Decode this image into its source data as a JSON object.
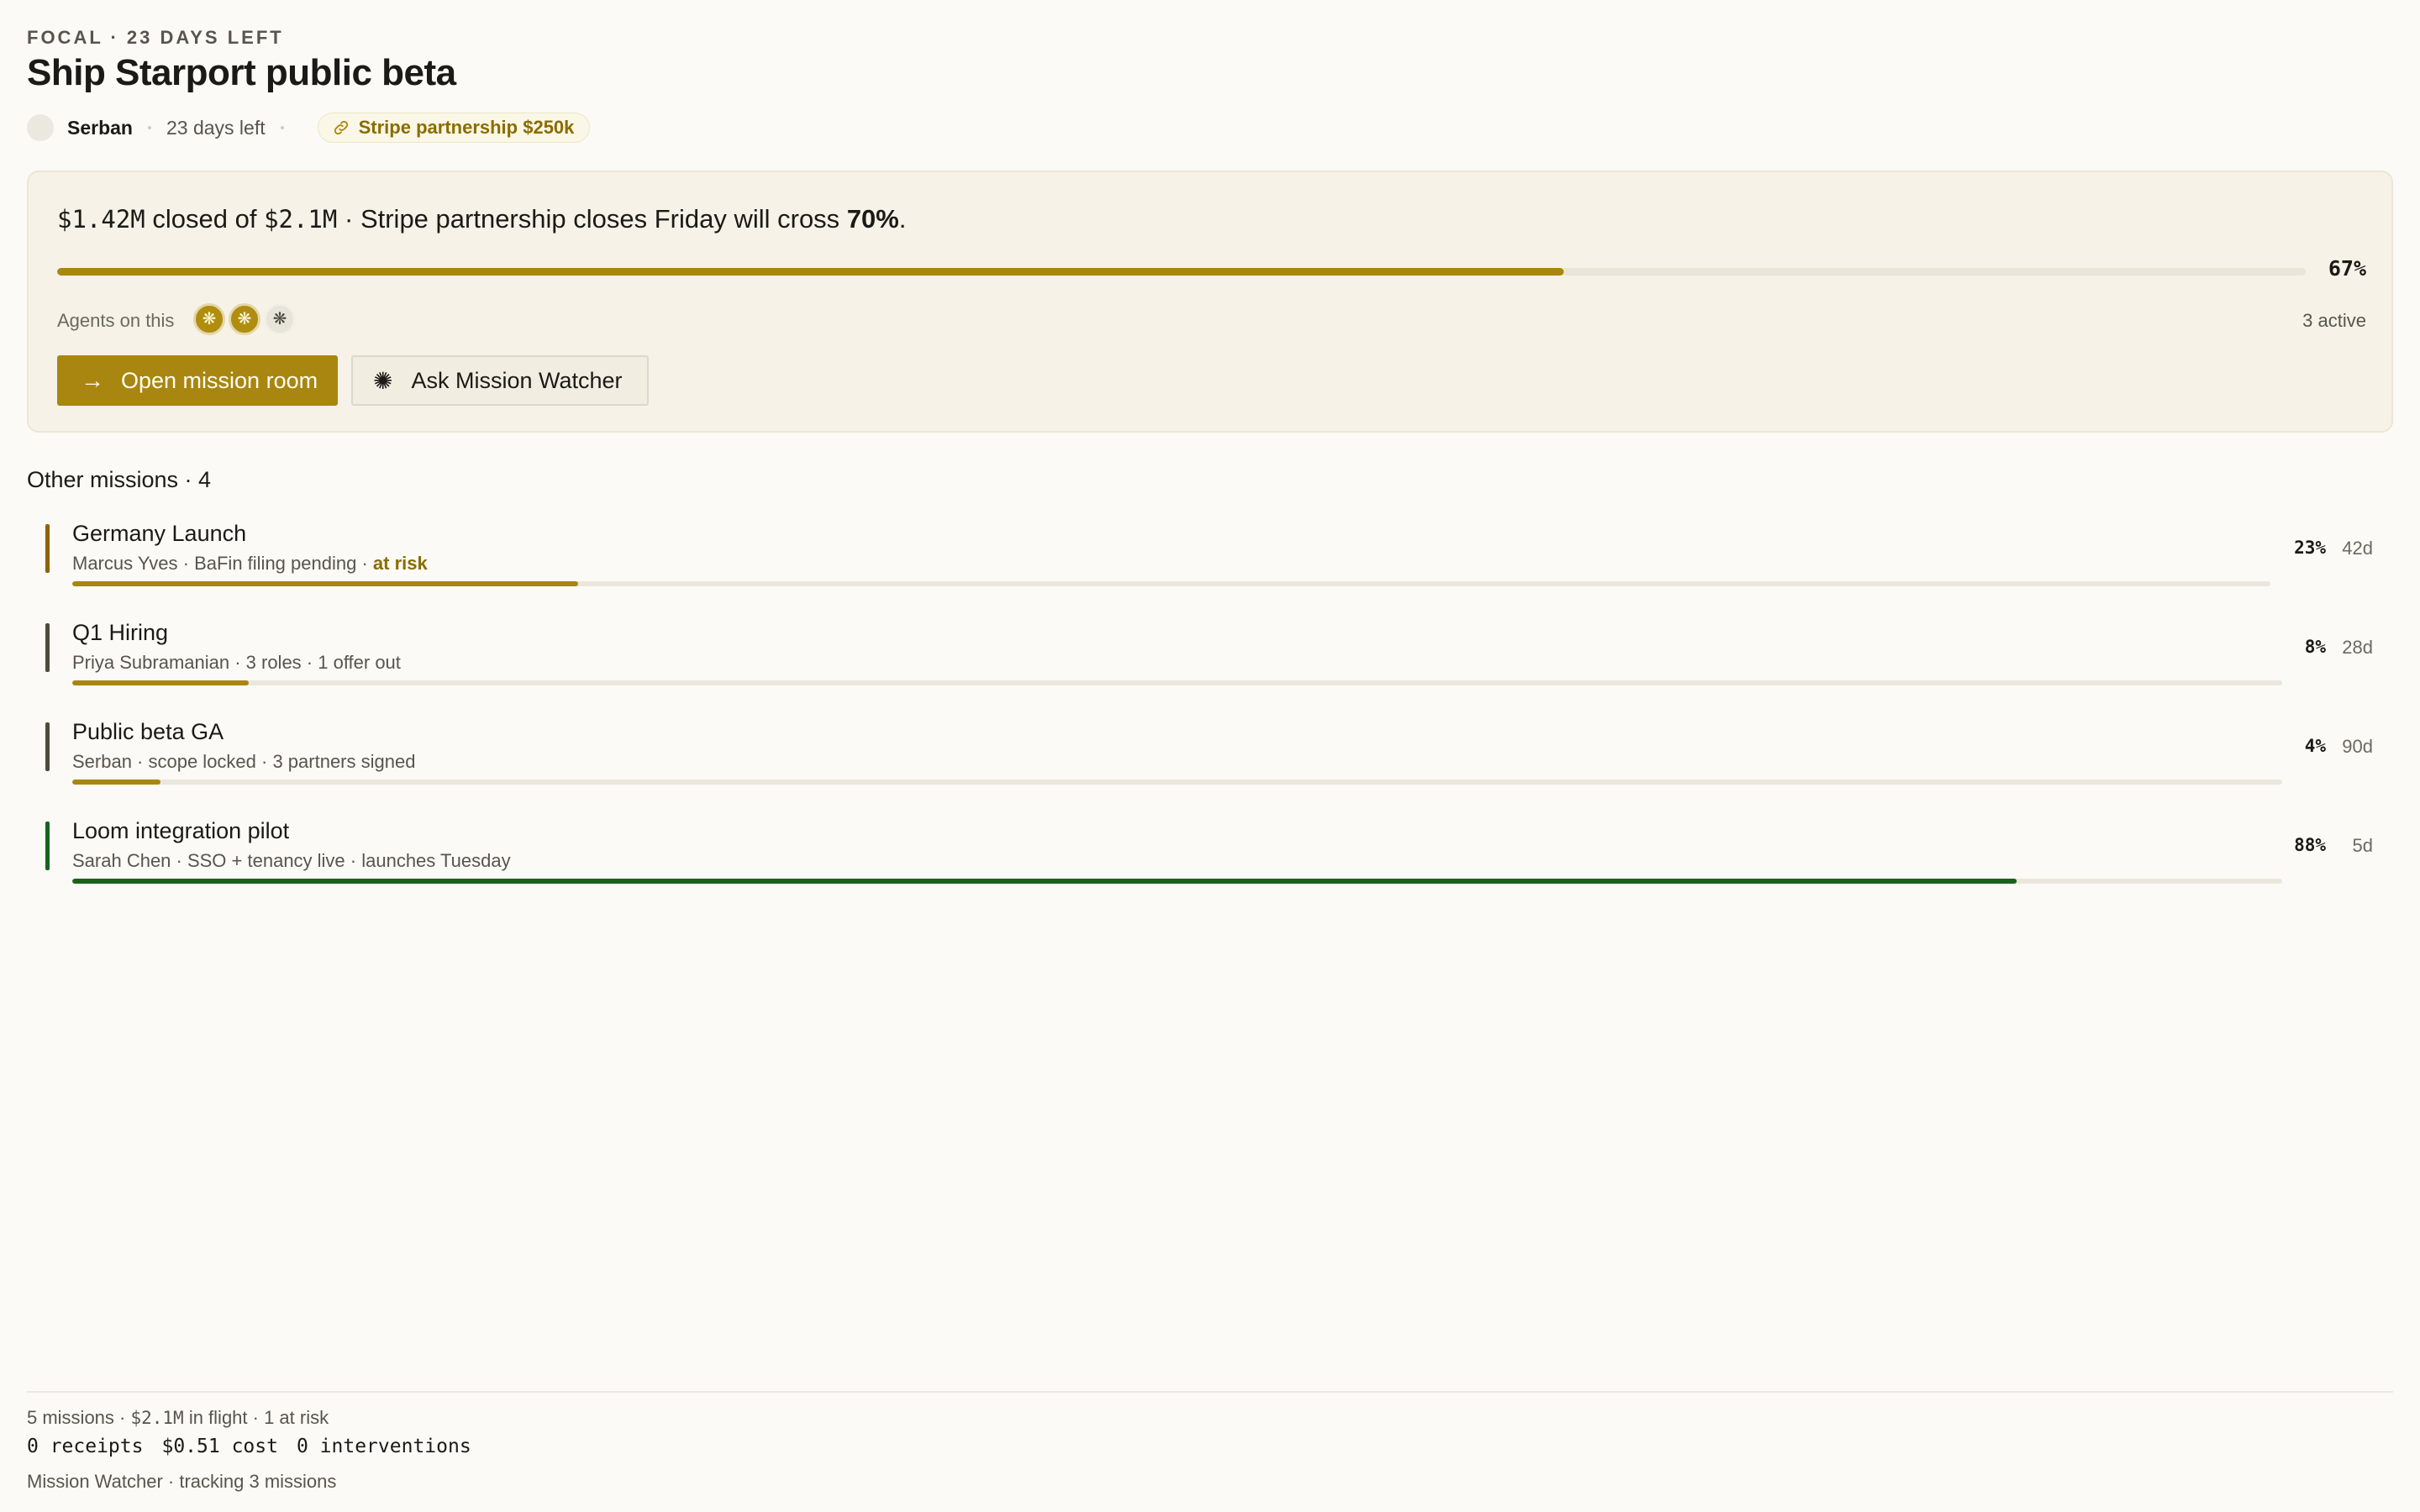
{
  "focal": {
    "eyebrow": "FOCAL · 23 DAYS LEFT",
    "title": "Ship Starport public beta",
    "owner": "Serban",
    "days_left": "23 days left",
    "link_label": "Stripe partnership $250k",
    "summary": {
      "closed": "$1.42M",
      "closed_of": " closed of ",
      "target": "$2.1M",
      "note": " · Stripe partnership closes Friday will cross ",
      "cross": "70%",
      "end": "."
    },
    "progress": 0.67,
    "progress_label": "67%",
    "agents_label": "Agents on this",
    "agents": [
      {
        "state": "active",
        "icon": "flower-icon"
      },
      {
        "state": "active",
        "icon": "flower-icon"
      },
      {
        "state": "idle",
        "icon": "flower-icon"
      }
    ],
    "active_count": "3 active",
    "open_button": "Open mission room",
    "ask_button": "Ask Mission Watcher"
  },
  "other": {
    "label": "Other missions · 4",
    "missions": [
      {
        "name": "Germany Launch",
        "sub": "Marcus Yves · BaFin filing pending · ",
        "risk": "at risk",
        "progress": 0.23,
        "pct": "23%",
        "days": "42d",
        "color": "#a8860f",
        "stripe": "#8a6408"
      },
      {
        "name": "Q1 Hiring",
        "sub": "Priya Subramanian · 3 roles · 1 offer out",
        "risk": "",
        "progress": 0.08,
        "pct": "8%",
        "days": "28d",
        "color": "#a8860f",
        "stripe": "#4f4a3c"
      },
      {
        "name": "Public beta GA",
        "sub": "Serban · scope locked · 3 partners signed",
        "risk": "",
        "progress": 0.04,
        "pct": "4%",
        "days": "90d",
        "color": "#a8860f",
        "stripe": "#4f4a3c"
      },
      {
        "name": "Loom integration pilot",
        "sub": "Sarah Chen · SSO + tenancy live · launches Tuesday",
        "risk": "",
        "progress": 0.88,
        "pct": "88%",
        "days": "5d",
        "color": "#19621c",
        "stripe": "#19621c"
      }
    ]
  },
  "footer": {
    "missions": "5 missions · ",
    "inflight_value": "$2.1M",
    "inflight_rest": " in flight · 1 at risk",
    "receipts": "0 receipts",
    "cost": "$0.51 cost",
    "interventions": "0 interventions",
    "watcher": "Mission Watcher · tracking 3 missions"
  },
  "colors": {
    "accent": "#a8860f",
    "success": "#19621c",
    "background": "#fbfaf6"
  }
}
